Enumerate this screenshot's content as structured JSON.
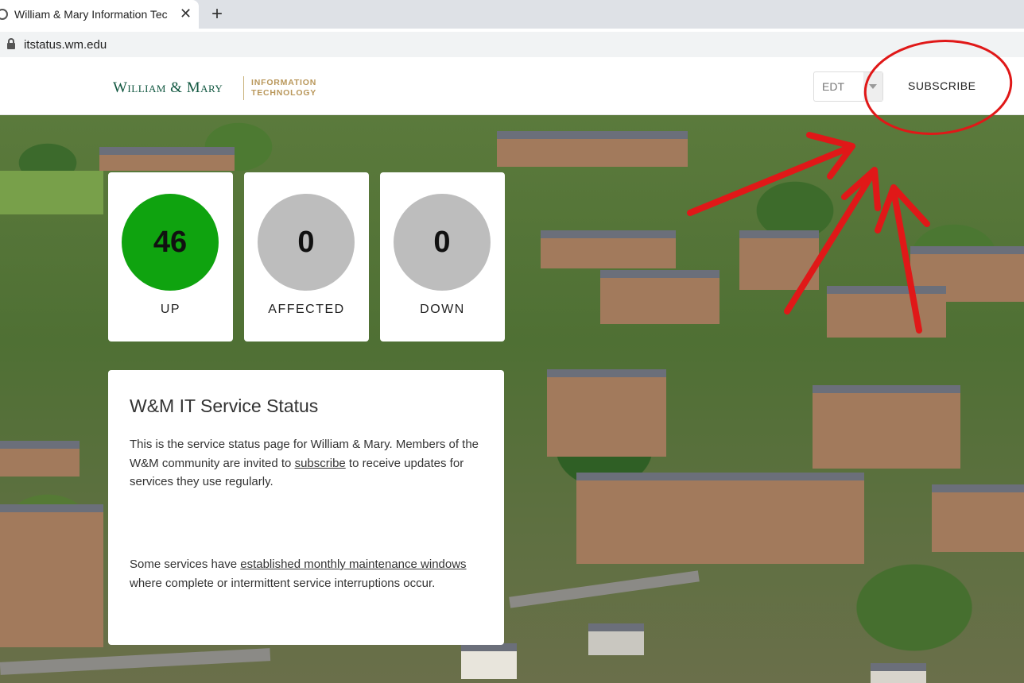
{
  "browser": {
    "tab_title": "William & Mary Information Tec",
    "tab_close": "✕",
    "new_tab": "+",
    "url": "itstatus.wm.edu"
  },
  "header": {
    "logo_name": "William & Mary",
    "logo_dept_line1": "INFORMATION",
    "logo_dept_line2": "TECHNOLOGY",
    "timezone": "EDT",
    "subscribe_label": "SUBSCRIBE"
  },
  "stats": [
    {
      "value": "46",
      "label": "UP",
      "color": "#0fa30f"
    },
    {
      "value": "0",
      "label": "AFFECTED",
      "color": "#bdbdbd"
    },
    {
      "value": "0",
      "label": "DOWN",
      "color": "#bdbdbd"
    }
  ],
  "info": {
    "title": "W&M IT Service Status",
    "p1_before": "This is the service status page for William & Mary. Members of the W&M community are invited to ",
    "p1_link": "subscribe",
    "p1_after": " to receive updates for services they use regularly.",
    "p2_before": "Some services have ",
    "p2_link": "established monthly maintenance windows",
    "p2_after": " where complete or intermittent service interruptions occur."
  },
  "colors": {
    "brand_green": "#115740",
    "brand_gold": "#b9975b",
    "annotation_red": "#e01818"
  }
}
